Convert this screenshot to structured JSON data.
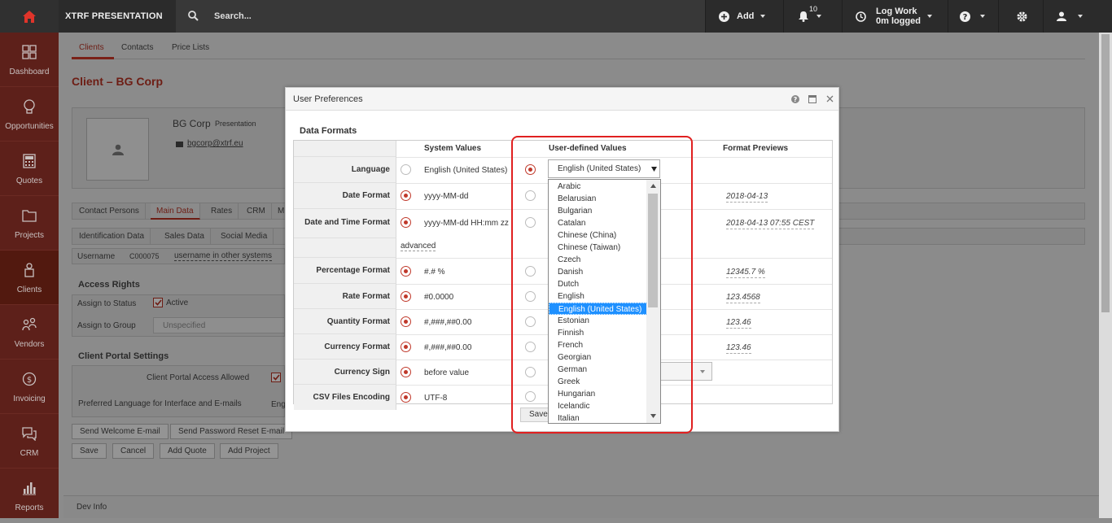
{
  "topbar": {
    "app_name": "XTRF PRESENTATION",
    "search_placeholder": "Search...",
    "add_label": "Add",
    "notification_count": "10",
    "logwork_line1": "Log Work",
    "logwork_line2": "0m logged"
  },
  "sidebar": {
    "items": [
      {
        "label": "Dashboard",
        "icon": "dashboard-icon"
      },
      {
        "label": "Opportunities",
        "icon": "lightbulb-icon"
      },
      {
        "label": "Quotes",
        "icon": "calculator-icon"
      },
      {
        "label": "Projects",
        "icon": "folder-icon"
      },
      {
        "label": "Clients",
        "icon": "clients-icon"
      },
      {
        "label": "Vendors",
        "icon": "vendors-icon"
      },
      {
        "label": "Invoicing",
        "icon": "dollar-icon"
      },
      {
        "label": "CRM",
        "icon": "chat-icon"
      },
      {
        "label": "Reports",
        "icon": "bar-chart-icon"
      }
    ]
  },
  "page": {
    "tabs": [
      "Clients",
      "Contacts",
      "Price Lists"
    ],
    "title": "Client – BG Corp",
    "client_name": "BG Corp",
    "client_tag": "Presentation",
    "client_email": "bgcorp@xtrf.eu",
    "subtabs": [
      "Contact Persons",
      "Main Data",
      "Rates",
      "CRM",
      "M"
    ],
    "subtabs2": [
      "Identification Data",
      "Sales Data",
      "Social Media"
    ],
    "username_label": "Username",
    "username_value": "C000075",
    "username_link": "username in other systems",
    "access_rights_title": "Access Rights",
    "assign_status_label": "Assign to Status",
    "active_label": "Active",
    "assign_group_label": "Assign to Group",
    "assign_group_value": "Unspecified",
    "portal_title": "Client Portal Settings",
    "portal_access_label": "Client Portal Access Allowed",
    "pref_lang_label": "Preferred Language for Interface and E-mails",
    "pref_lang_value": "Eng",
    "btn_welcome": "Send Welcome E-mail",
    "btn_reset": "Send Password Reset E-mail",
    "btn_save": "Save",
    "btn_cancel": "Cancel",
    "btn_add_quote": "Add Quote",
    "btn_add_project": "Add Project",
    "footer": "Dev Info"
  },
  "modal": {
    "title": "User Preferences",
    "section": "Data Formats",
    "col_system": "System Values",
    "col_user": "User-defined Values",
    "col_preview": "Format Previews",
    "advanced_link": "advanced",
    "save_label": "Save",
    "rows": [
      {
        "label": "Language",
        "system": "English (United States)",
        "preview": ""
      },
      {
        "label": "Date Format",
        "system": "yyyy-MM-dd",
        "preview": "2018-04-13"
      },
      {
        "label": "Date and Time Format",
        "system": "yyyy-MM-dd HH:mm zz",
        "preview": "2018-04-13 07:55 CEST"
      },
      {
        "label": "Percentage Format",
        "system": "#.# %",
        "preview": "12345.7 %"
      },
      {
        "label": "Rate Format",
        "system": "#0.0000",
        "preview": "123.4568"
      },
      {
        "label": "Quantity Format",
        "system": "#,###,##0.00",
        "preview": "123.46"
      },
      {
        "label": "Currency Format",
        "system": "#,###,##0.00",
        "preview": "123.46"
      },
      {
        "label": "Currency Sign",
        "system": "before value",
        "preview": ""
      },
      {
        "label": "CSV Files Encoding",
        "system": "UTF-8",
        "preview": ""
      }
    ],
    "language_selected": "English (United States)",
    "language_options": [
      "Arabic",
      "Belarusian",
      "Bulgarian",
      "Catalan",
      "Chinese (China)",
      "Chinese (Taiwan)",
      "Czech",
      "Danish",
      "Dutch",
      "English",
      "English (United States)",
      "Estonian",
      "Finnish",
      "French",
      "Georgian",
      "German",
      "Greek",
      "Hungarian",
      "Icelandic",
      "Italian"
    ]
  },
  "colors": {
    "brand_red": "#c0392b",
    "highlight": "#e02020",
    "selected_option": "#1e90ff"
  }
}
